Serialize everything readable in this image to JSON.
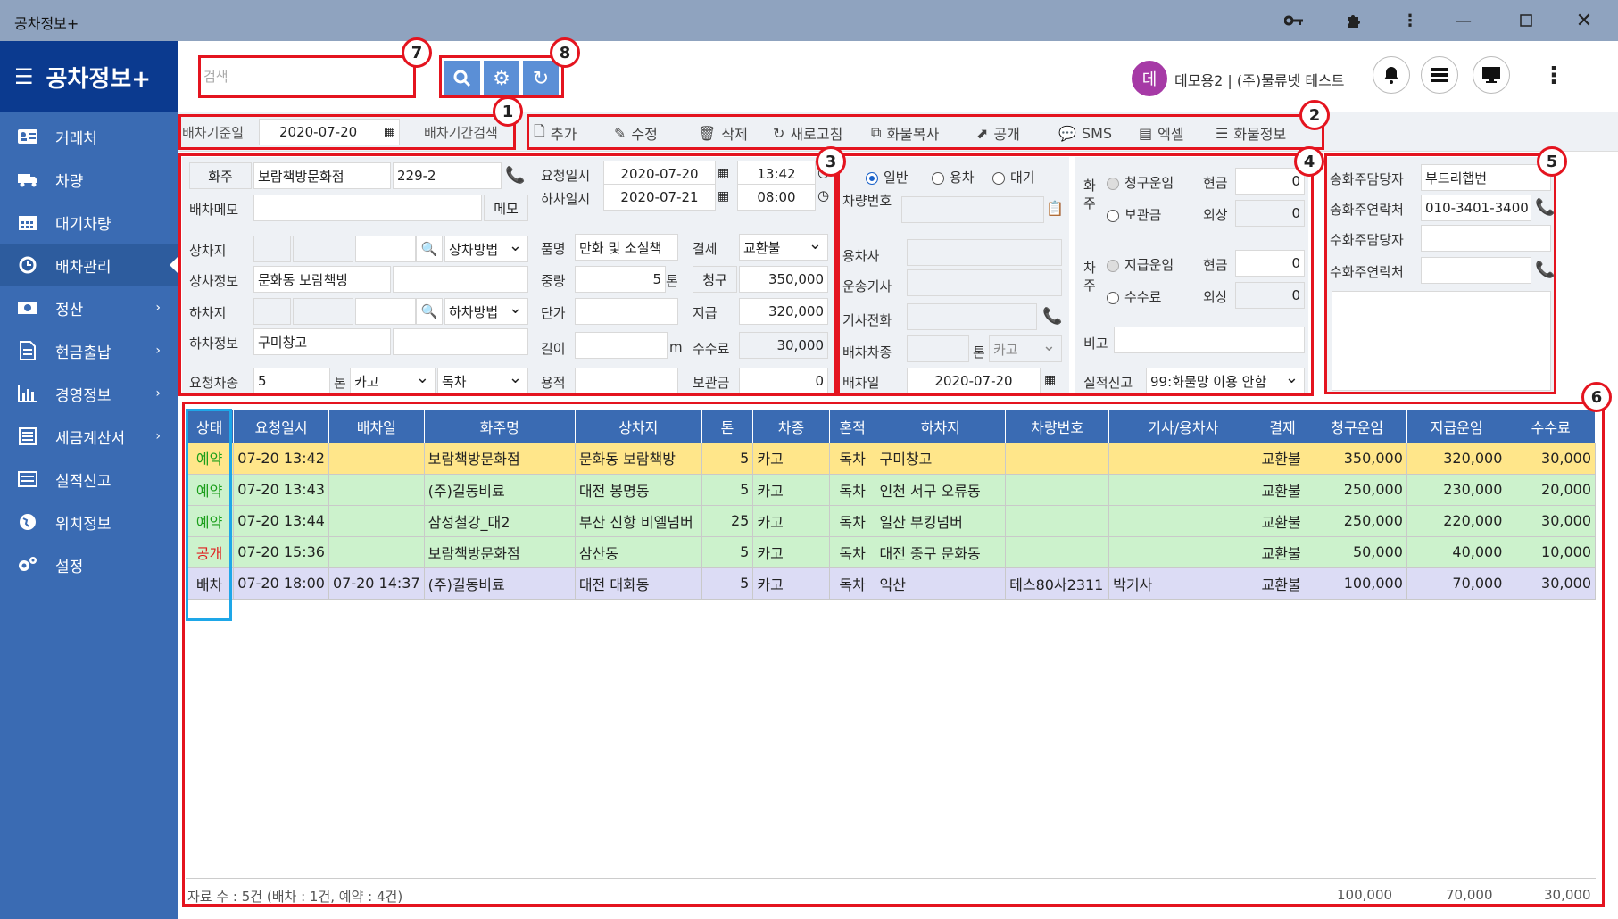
{
  "window": {
    "title": "공차정보+"
  },
  "brand": {
    "title": "공차정보+"
  },
  "sidebar": {
    "items": [
      {
        "label": "거래처",
        "icon": "contact-card-icon"
      },
      {
        "label": "차량",
        "icon": "truck-icon"
      },
      {
        "label": "대기차량",
        "icon": "calendar-icon"
      },
      {
        "label": "배차관리",
        "icon": "clock-icon",
        "active": true
      },
      {
        "label": "정산",
        "icon": "money-icon",
        "chevron": true
      },
      {
        "label": "현금출납",
        "icon": "document-icon",
        "chevron": true
      },
      {
        "label": "경영정보",
        "icon": "bar-chart-icon",
        "chevron": true
      },
      {
        "label": "세금계산서",
        "icon": "invoice-icon",
        "chevron": true
      },
      {
        "label": "실적신고",
        "icon": "list-icon"
      },
      {
        "label": "위치정보",
        "icon": "globe-icon"
      },
      {
        "label": "설정",
        "icon": "gears-icon"
      }
    ]
  },
  "header": {
    "search_placeholder": "검색",
    "avatar_letter": "데",
    "user": "데모용2 | (주)물류넷 테스트"
  },
  "datebar": {
    "label": "배차기준일",
    "date": "2020-07-20",
    "range_label": "배차기간검색"
  },
  "toolbar": {
    "add": "추가",
    "edit": "수정",
    "delete": "삭제",
    "refresh": "새로고침",
    "copy": "화물복사",
    "public": "공개",
    "sms": "SMS",
    "excel": "엑셀",
    "cargo_info": "화물정보"
  },
  "badges": [
    "1",
    "2",
    "3",
    "4",
    "5",
    "6",
    "7",
    "8"
  ],
  "form": {
    "shipper_label": "화주",
    "shipper": "보람책방문화점",
    "shipper_code": "229-2",
    "memo_label": "배차메모",
    "memo_btn": "메모",
    "load_label": "상차지",
    "load_method": "상차방법",
    "load_info_label": "상차정보",
    "load_info": "문화동 보람책방",
    "unload_label": "하차지",
    "unload_method": "하차방법",
    "unload_info_label": "하차정보",
    "unload_info": "구미창고",
    "req_type_label": "요청차종",
    "req_ton": "5",
    "ton_unit": "톤",
    "req_car": "카고",
    "req_mix": "독차",
    "req_date_label": "요청일시",
    "req_date": "2020-07-20",
    "req_time": "13:42",
    "unload_date_label": "하차일시",
    "unload_date": "2020-07-21",
    "unload_time": "08:00",
    "item_label": "품명",
    "item": "만화 및 소설책",
    "weight_label": "중량",
    "weight": "5",
    "weight_unit": "톤",
    "unit_price_label": "단가",
    "length_label": "길이",
    "length_unit": "m",
    "volume_label": "용적",
    "pay_label": "결제",
    "pay": "교환불",
    "charge_label": "청구",
    "charge": "350,000",
    "paid_label": "지급",
    "paid": "320,000",
    "fee_label": "수수료",
    "fee": "30,000",
    "storage_label": "보관금",
    "storage": "0"
  },
  "vehicle": {
    "mode_normal": "일반",
    "mode_rent": "용차",
    "mode_wait": "대기",
    "car_no_label": "차량번호",
    "rent_company_label": "용차사",
    "driver_label": "운송기사",
    "driver_phone_label": "기사전화",
    "car_type_label": "배차차종",
    "car_type_unit": "톤",
    "car_type": "카고",
    "dispatch_date_label": "배차일",
    "dispatch_date": "2020-07-20"
  },
  "payment": {
    "shipper_side": "화주",
    "charge_fare": "청구운임",
    "storage": "보관금",
    "cash": "현금",
    "credit": "외상",
    "cash_val": "0",
    "credit_val": "0",
    "car_side": "차주",
    "pay_fare": "지급운임",
    "fee": "수수료",
    "cash2": "현금",
    "credit2": "외상",
    "cash2_val": "0",
    "credit2_val": "0",
    "note_label": "비고",
    "report_label": "실적신고",
    "report": "99:화물망 이용 안함"
  },
  "contact": {
    "sender_mgr_label": "송화주담당자",
    "sender_mgr": "부드리햅번",
    "sender_tel_label": "송화주연락처",
    "sender_tel": "010-3401-3400",
    "recv_mgr_label": "수화주담당자",
    "recv_tel_label": "수화주연락처"
  },
  "grid": {
    "columns": [
      "상태",
      "요청일시",
      "배차일",
      "화주명",
      "상차지",
      "톤",
      "차종",
      "혼적",
      "하차지",
      "차량번호",
      "기사/용차사",
      "결제",
      "청구운임",
      "지급운임",
      "수수료"
    ],
    "rows": [
      {
        "status": "예약",
        "status_color": "#1a9e1a",
        "row": "y",
        "req": "07-20 13:42",
        "disp": "",
        "shipper": "보람책방문화점",
        "load": "문화동 보람책방",
        "ton": "5",
        "car": "카고",
        "mix": "독차",
        "unload": "구미창고",
        "carno": "",
        "driver": "",
        "pay": "교환불",
        "charge": "350,000",
        "paid": "320,000",
        "fee": "30,000"
      },
      {
        "status": "예약",
        "status_color": "#1a9e1a",
        "row": "g",
        "req": "07-20 13:43",
        "disp": "",
        "shipper": "(주)길동비료",
        "load": "대전 봉명동",
        "ton": "5",
        "car": "카고",
        "mix": "독차",
        "unload": "인천 서구 오류동",
        "carno": "",
        "driver": "",
        "pay": "교환불",
        "charge": "250,000",
        "paid": "230,000",
        "fee": "20,000"
      },
      {
        "status": "예약",
        "status_color": "#1a9e1a",
        "row": "g",
        "req": "07-20 13:44",
        "disp": "",
        "shipper": "삼성철강_대2",
        "load": "부산 신항 비엘넘버",
        "ton": "25",
        "car": "카고",
        "mix": "독차",
        "unload": "일산 부킹넘버",
        "carno": "",
        "driver": "",
        "pay": "교환불",
        "charge": "250,000",
        "paid": "220,000",
        "fee": "30,000"
      },
      {
        "status": "공개",
        "status_color": "#e02020",
        "row": "g",
        "req": "07-20 15:36",
        "disp": "",
        "shipper": "보람책방문화점",
        "load": "삼산동",
        "ton": "5",
        "car": "카고",
        "mix": "독차",
        "unload": "대전 중구 문화동",
        "carno": "",
        "driver": "",
        "pay": "교환불",
        "charge": "50,000",
        "paid": "40,000",
        "fee": "10,000"
      },
      {
        "status": "배차",
        "status_color": "#222222",
        "row": "p",
        "req": "07-20 18:00",
        "disp": "07-20 14:37",
        "shipper": "(주)길동비료",
        "load": "대전 대화동",
        "ton": "5",
        "car": "카고",
        "mix": "독차",
        "unload": "익산",
        "carno": "테스80사2311",
        "driver": "박기사",
        "pay": "교환불",
        "charge": "100,000",
        "paid": "70,000",
        "fee": "30,000"
      }
    ],
    "footer_count": "자료 수 : 5건 (배차 : 1건, 예약 : 4건)",
    "footer_charge": "100,000",
    "footer_paid": "70,000",
    "footer_fee": "30,000"
  },
  "colors": {
    "brand": "#0b3a8f",
    "sidebar": "#3a6bb3",
    "header_bar": "#8fa3bf",
    "highlight": "#e4141f",
    "row_yellow": "#ffe68a",
    "row_green": "#ccf2cc",
    "row_purple": "#dcdcf5",
    "avatar": "#a63aa6"
  }
}
